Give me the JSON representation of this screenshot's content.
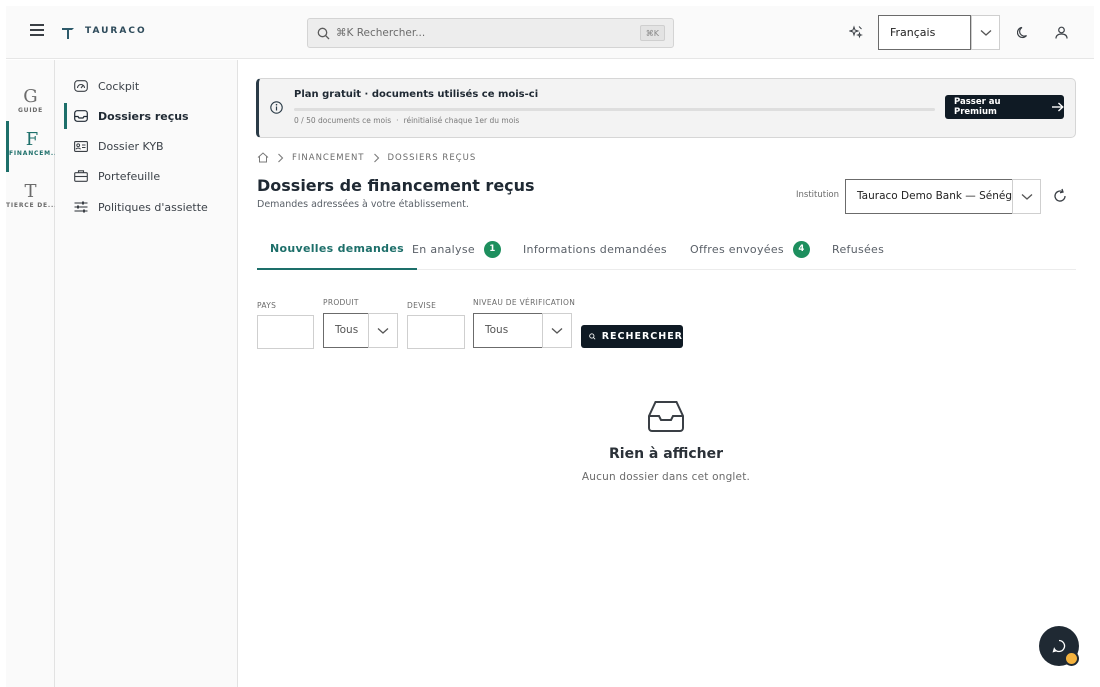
{
  "header": {
    "brand": "TAURACO",
    "search_placeholder": "⌘K Rechercher...",
    "search_shortcut": "⌘K",
    "language": "Français"
  },
  "rail": [
    {
      "letter": "G",
      "label": "GUIDE",
      "active": false
    },
    {
      "letter": "F",
      "label": "FINANCEM...",
      "active": true
    },
    {
      "letter": "T",
      "label": "TIERCE DÉ...",
      "active": false
    }
  ],
  "sidenav": [
    {
      "label": "Cockpit",
      "icon": "gauge-icon",
      "active": false
    },
    {
      "label": "Dossiers reçus",
      "icon": "inbox-icon",
      "active": true
    },
    {
      "label": "Dossier KYB",
      "icon": "id-card-icon",
      "active": false
    },
    {
      "label": "Portefeuille",
      "icon": "briefcase-icon",
      "active": false
    },
    {
      "label": "Politiques d'assiette",
      "icon": "sliders-icon",
      "active": false
    }
  ],
  "banner": {
    "title": "Plan gratuit · documents utilisés ce mois-ci",
    "usage_text": "0 / 50 documents ce mois",
    "reset_text": "réinitialisé chaque 1er du mois",
    "usage_fraction": 0,
    "cta": "Passer au Premium"
  },
  "breadcrumb": [
    "FINANCEMENT",
    "DOSSIERS REÇUS"
  ],
  "page": {
    "title": "Dossiers de financement reçus",
    "subtitle": "Demandes adressées à votre établissement.",
    "institution_label": "Institution",
    "institution_value": "Tauraco Demo Bank — Sénégal"
  },
  "tabs": [
    {
      "label": "Nouvelles demandes",
      "count": null,
      "active": true
    },
    {
      "label": "En analyse",
      "count": "1",
      "active": false
    },
    {
      "label": "Informations demandées",
      "count": null,
      "active": false
    },
    {
      "label": "Offres envoyées",
      "count": "4",
      "active": false
    },
    {
      "label": "Refusées",
      "count": null,
      "active": false
    }
  ],
  "filters": {
    "country_label": "PAYS",
    "country_value": "",
    "product_label": "PRODUIT",
    "product_value": "Tous",
    "currency_label": "DEVISE",
    "currency_value": "",
    "verification_label": "NIVEAU DE VÉRIFICATION",
    "verification_value": "Tous",
    "search_button": "RECHERCHER"
  },
  "empty_state": {
    "title": "Rien à afficher",
    "subtitle": "Aucun dossier dans cet onglet."
  },
  "colors": {
    "accent": "#1d6f6a",
    "dark": "#0f1a24",
    "badge": "#1d8f5e"
  }
}
